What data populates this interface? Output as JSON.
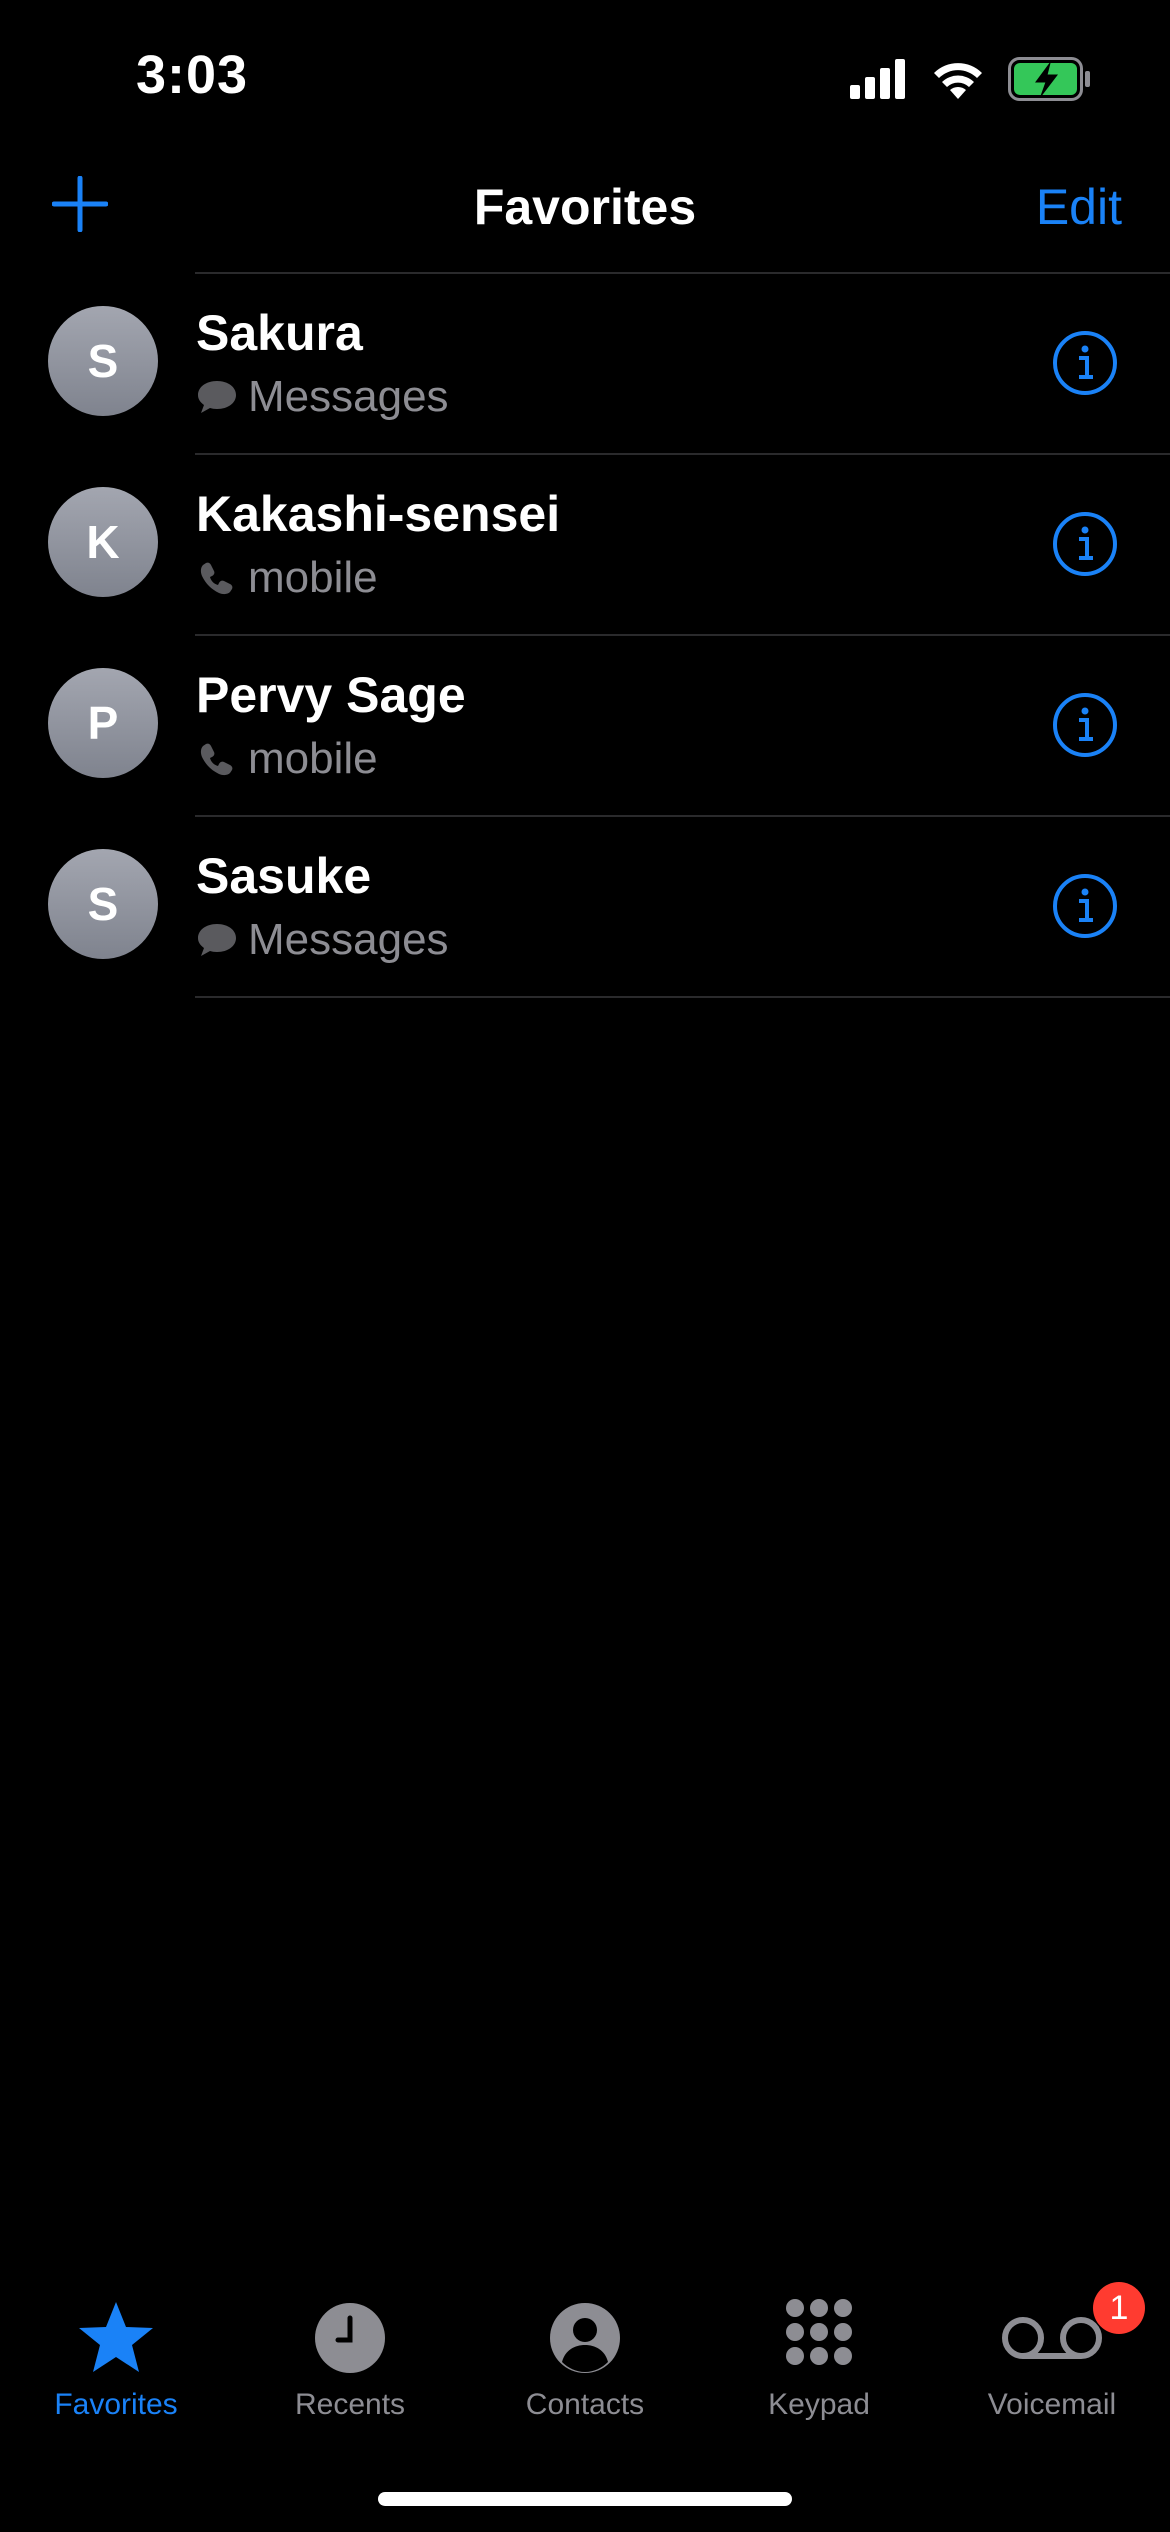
{
  "status_bar": {
    "time": "3:03"
  },
  "nav": {
    "title": "Favorites",
    "edit_label": "Edit"
  },
  "colors": {
    "accent": "#1a82f7",
    "secondary_text": "#8d8d93",
    "badge": "#ff3b30",
    "battery_fill": "#34c759"
  },
  "favorites": [
    {
      "initial": "S",
      "name": "Sakura",
      "type": "Messages",
      "type_icon": "message-bubble-icon"
    },
    {
      "initial": "K",
      "name": "Kakashi-sensei",
      "type": "mobile",
      "type_icon": "phone-icon"
    },
    {
      "initial": "P",
      "name": "Pervy Sage",
      "type": "mobile",
      "type_icon": "phone-icon"
    },
    {
      "initial": "S",
      "name": "Sasuke",
      "type": "Messages",
      "type_icon": "message-bubble-icon"
    }
  ],
  "tabs": [
    {
      "label": "Favorites",
      "icon": "star-icon",
      "active": true
    },
    {
      "label": "Recents",
      "icon": "clock-icon",
      "active": false
    },
    {
      "label": "Contacts",
      "icon": "person-icon",
      "active": false
    },
    {
      "label": "Keypad",
      "icon": "keypad-icon",
      "active": false
    },
    {
      "label": "Voicemail",
      "icon": "voicemail-icon",
      "active": false,
      "badge": "1"
    }
  ]
}
